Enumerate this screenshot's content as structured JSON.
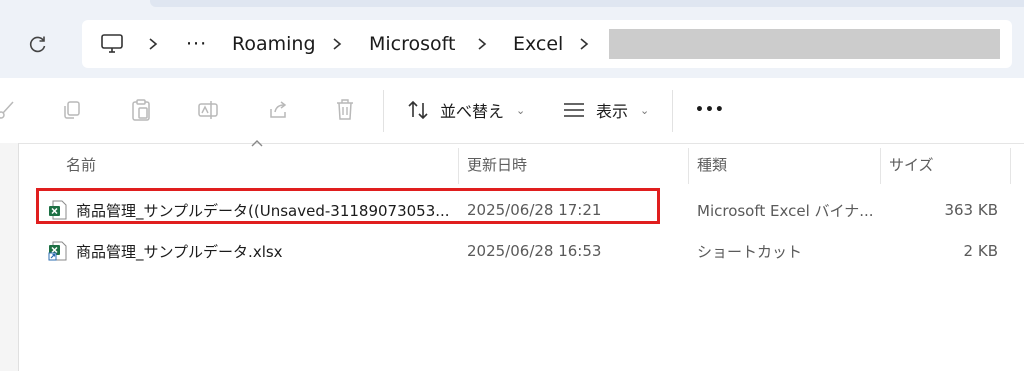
{
  "address_bar": {
    "crumbs": [
      "Roaming",
      "Microsoft",
      "Excel"
    ],
    "overflow": "···"
  },
  "toolbar": {
    "sort_label": "並べ替え",
    "view_label": "表示",
    "more_label": "•••"
  },
  "columns": {
    "name": "名前",
    "modified": "更新日時",
    "type": "種類",
    "size": "サイズ"
  },
  "files": [
    {
      "name": "商品管理_サンプルデータ((Unsaved-31189073053...",
      "modified": "2025/06/28 17:21",
      "type": "Microsoft Excel バイナ...",
      "size": "363 KB",
      "icon": "excel-file-icon"
    },
    {
      "name": "商品管理_サンプルデータ.xlsx",
      "modified": "2025/06/28 16:53",
      "type": "ショートカット",
      "size": "2 KB",
      "icon": "excel-shortcut-icon"
    }
  ],
  "colors": {
    "highlight": "#e01e1e",
    "excel_green": "#1d7044"
  }
}
